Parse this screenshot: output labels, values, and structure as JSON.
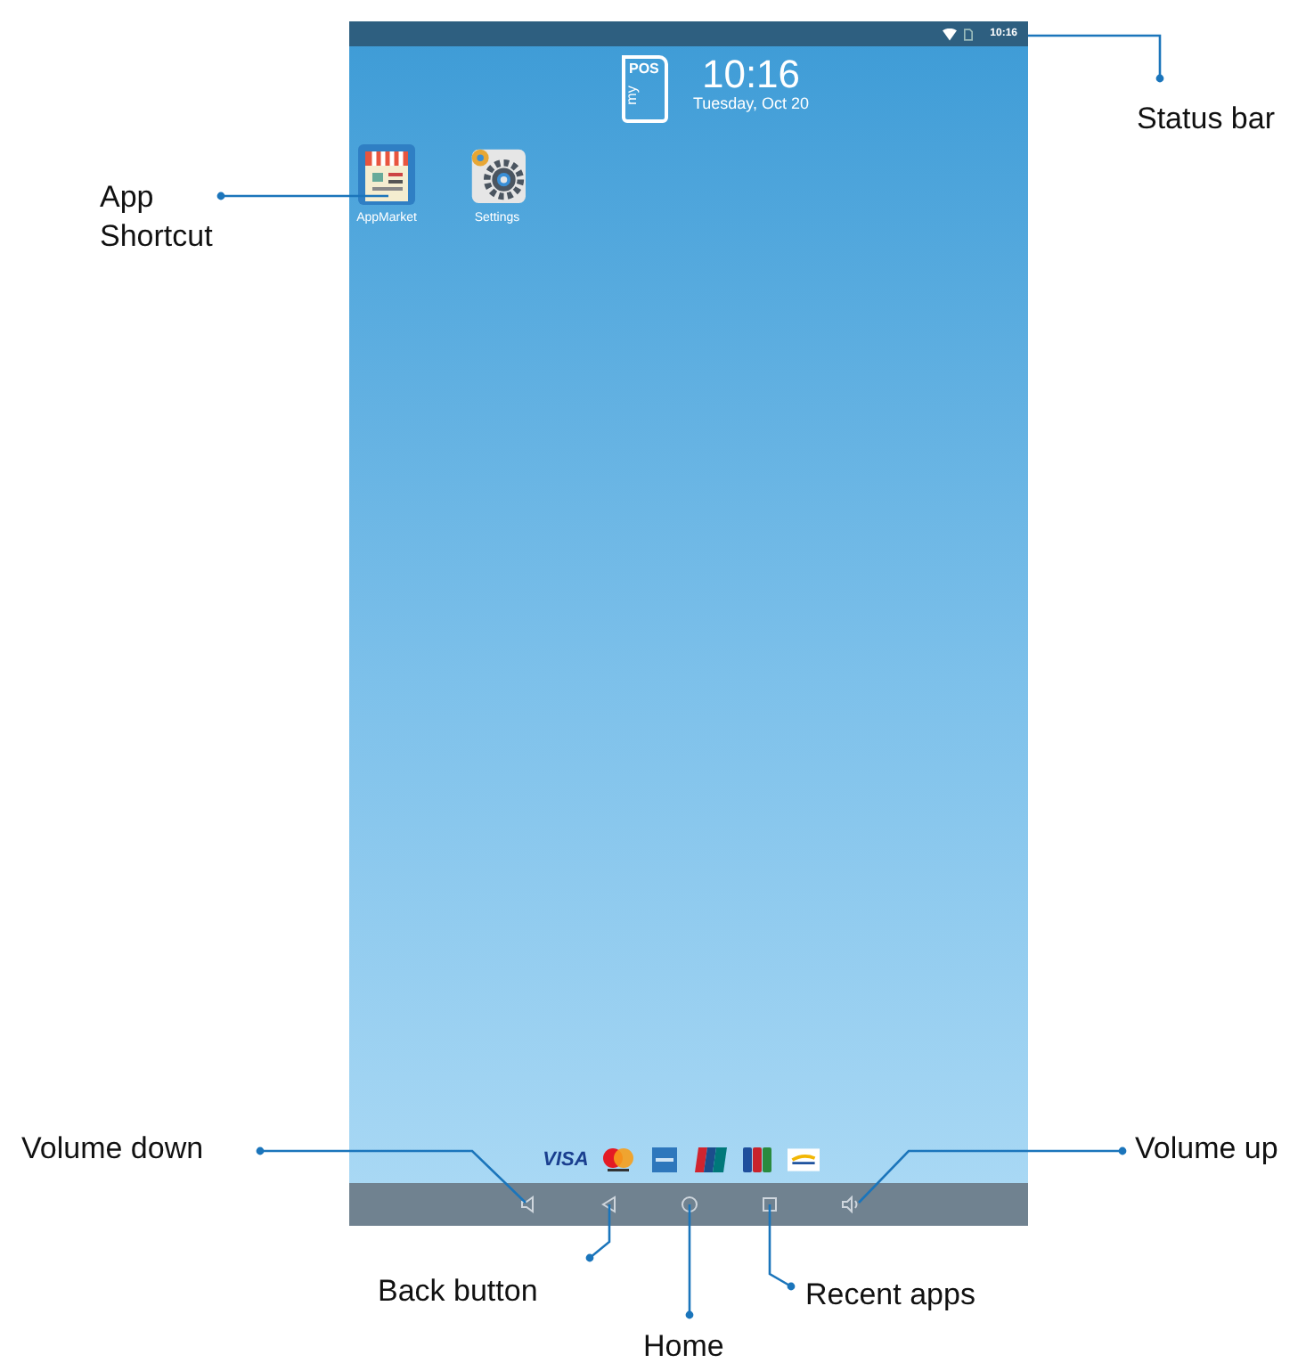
{
  "status_bar": {
    "time": "10:16"
  },
  "logo": {
    "top": "POS",
    "side": "my"
  },
  "clock": {
    "time": "10:16",
    "date": "Tuesday, Oct 20"
  },
  "apps": [
    {
      "label": "AppMarket",
      "kind": "market"
    },
    {
      "label": "Settings",
      "kind": "settings"
    }
  ],
  "payment_logos": [
    {
      "kind": "visa",
      "text": "VISA"
    },
    {
      "kind": "mastercard"
    },
    {
      "kind": "amex"
    },
    {
      "kind": "unionpay"
    },
    {
      "kind": "jcb"
    },
    {
      "kind": "other"
    }
  ],
  "nav_buttons": [
    {
      "kind": "volume-down"
    },
    {
      "kind": "back"
    },
    {
      "kind": "home"
    },
    {
      "kind": "recent"
    },
    {
      "kind": "volume-up"
    }
  ],
  "annotations": [
    {
      "label": "Status bar"
    },
    {
      "label": "App Shortcut"
    },
    {
      "label": "Volume down"
    },
    {
      "label": "Volume up"
    },
    {
      "label": "Back button"
    },
    {
      "label": "Home"
    },
    {
      "label": "Recent apps"
    }
  ]
}
